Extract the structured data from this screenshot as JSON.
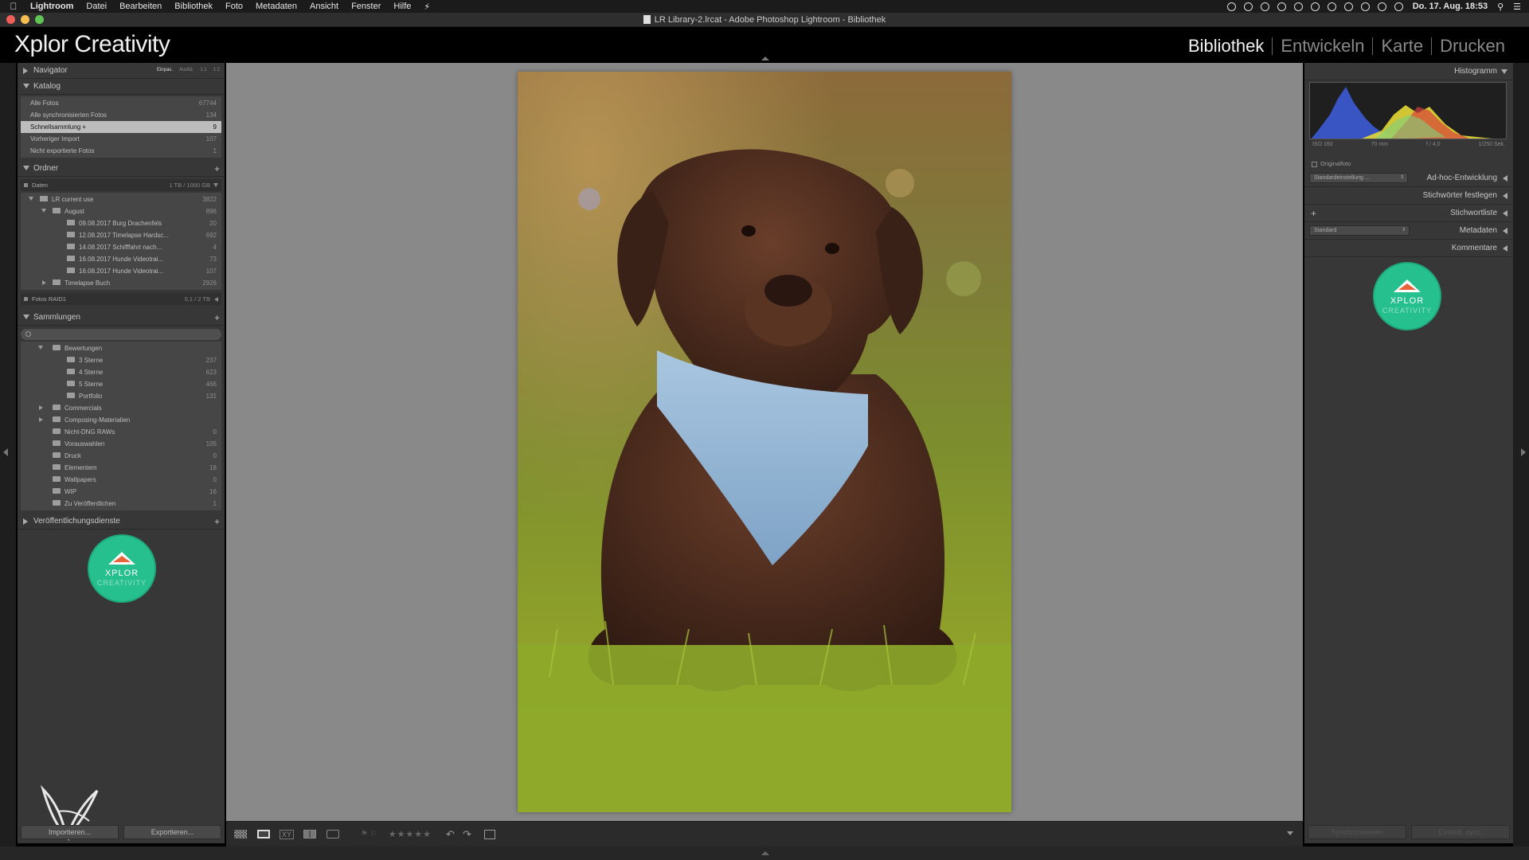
{
  "menubar": {
    "app": "Lightroom",
    "items": [
      "Datei",
      "Bearbeiten",
      "Bibliothek",
      "Foto",
      "Metadaten",
      "Ansicht",
      "Fenster",
      "Hilfe"
    ],
    "clock": "Do. 17. Aug. 18:53"
  },
  "window": {
    "title": "LR Library-2.lrcat - Adobe Photoshop Lightroom - Bibliothek"
  },
  "identity": {
    "plate": "Xplor Creativity"
  },
  "modules": [
    "Bibliothek",
    "Entwickeln",
    "Karte",
    "Drucken"
  ],
  "navigator": {
    "label": "Navigator",
    "options": [
      "Einpas.",
      "Ausfül.",
      "1:1",
      "1:2"
    ]
  },
  "catalog": {
    "label": "Katalog",
    "items": [
      {
        "name": "Alle Fotos",
        "count": "67744"
      },
      {
        "name": "Alle synchronisierten Fotos",
        "count": "134"
      },
      {
        "name": "Schnellsammlung +",
        "count": "9"
      },
      {
        "name": "Vorheriger Import",
        "count": "107"
      },
      {
        "name": "Nicht exportierte Fotos",
        "count": "1"
      }
    ]
  },
  "folders": {
    "label": "Ordner",
    "volume1": {
      "name": "Daten",
      "usage": "1 TB / 1000 GB"
    },
    "items": [
      {
        "name": "LR current use",
        "count": "3822"
      },
      {
        "name": "August",
        "count": "896"
      },
      {
        "name": "09.08.2017 Burg Drachenfels",
        "count": "20"
      },
      {
        "name": "12.08.2017 Timelapse Hardsc...",
        "count": "692"
      },
      {
        "name": "14.08.2017 Schifffahrt nach...",
        "count": "4"
      },
      {
        "name": "16.08.2017 Hunde Videotrai...",
        "count": "73"
      },
      {
        "name": "16.08.2017 Hunde Videotrai...",
        "count": "107"
      },
      {
        "name": "Timelapse Buch",
        "count": "2926"
      }
    ],
    "volume2": {
      "name": "Fotos RAID1",
      "usage": "0,1 / 2 TB"
    }
  },
  "collections": {
    "label": "Sammlungen",
    "items": [
      {
        "name": "Bewertungen",
        "count": ""
      },
      {
        "name": "3 Sterne",
        "count": "237"
      },
      {
        "name": "4 Sterne",
        "count": "623"
      },
      {
        "name": "5 Sterne",
        "count": "466"
      },
      {
        "name": "Portfolio",
        "count": "131"
      },
      {
        "name": "Commercials",
        "count": ""
      },
      {
        "name": "Composing-Materialien",
        "count": ""
      },
      {
        "name": "Nicht-DNG RAWs",
        "count": "0"
      },
      {
        "name": "Vorauswahlen",
        "count": "105"
      },
      {
        "name": "Druck",
        "count": "0"
      },
      {
        "name": "Elementem",
        "count": "18"
      },
      {
        "name": "Wallpapers",
        "count": "0"
      },
      {
        "name": "WIP",
        "count": "16"
      },
      {
        "name": "Zu Veröffentlichen",
        "count": "1"
      }
    ]
  },
  "publish": {
    "label": "Veröffentlichungsdienste"
  },
  "badge": {
    "line1": "XPLOR",
    "line2": "CREATIVITY"
  },
  "left_buttons": {
    "import": "Importieren...",
    "export": "Exportieren..."
  },
  "right_panels": {
    "histogram": "Histogramm",
    "histo_meta": [
      "ISO 160",
      "70 mm",
      "f / 4,0",
      "1/250 Sek."
    ],
    "original": "Originalfoto",
    "quick_develop": "Ad-hoc-Entwicklung",
    "preset": "Standardeinstellung ...",
    "keywording": "Stichwörter festlegen",
    "keyword_list": "Stichwortliste",
    "metadata": "Metadaten",
    "metadata_preset": "Standard",
    "comments": "Kommentare"
  },
  "right_buttons": {
    "sync": "Synchronisieren",
    "settings": "Einstell. sync."
  },
  "toolbar": {
    "stars": "★★★★★"
  },
  "colors": {
    "panel": "#373737",
    "background": "#898989",
    "selection": "#bdbdbd",
    "badge": "#25c08e"
  }
}
